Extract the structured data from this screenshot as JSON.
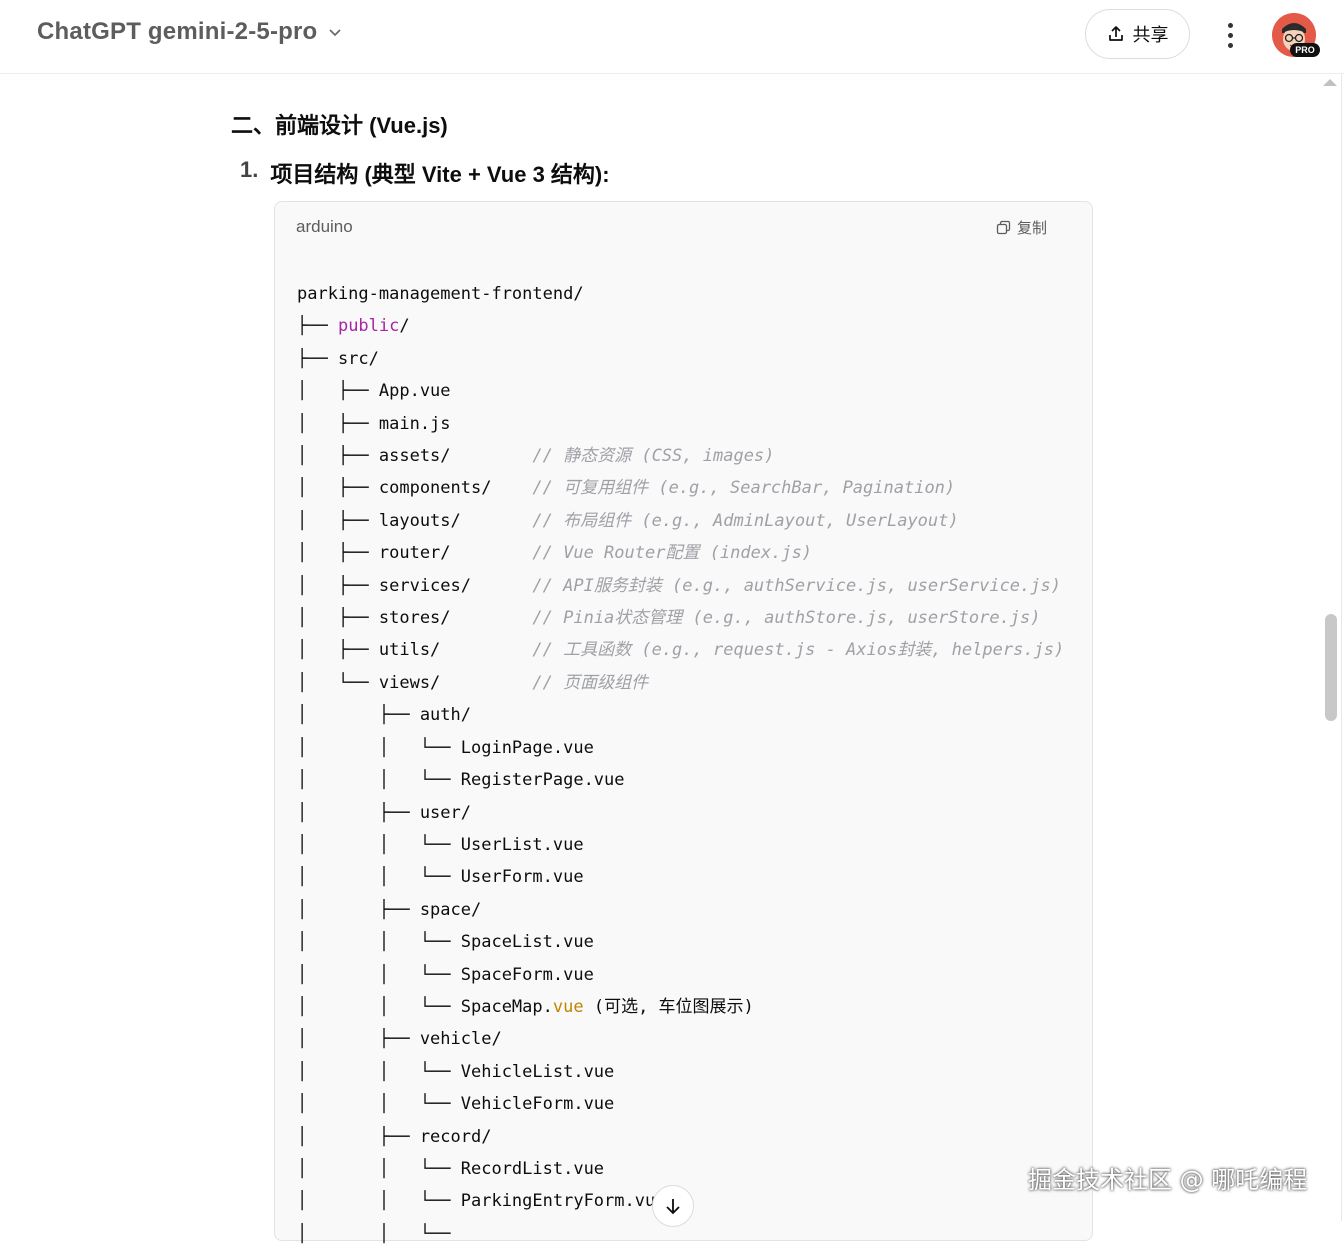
{
  "header": {
    "title": "ChatGPT gemini-2-5-pro",
    "share_label": "共享",
    "avatar_badge": "PRO"
  },
  "content": {
    "section_heading": "二、前端设计 (Vue.js)",
    "item_number": "1.",
    "item_heading": "项目结构 (典型 Vite + Vue 3 结构):"
  },
  "code_block": {
    "language": "arduino",
    "copy_label": "复制",
    "lines": [
      [
        {
          "t": "parking-management-frontend/"
        }
      ],
      [
        {
          "t": "├── "
        },
        {
          "t": "public",
          "c": "kw"
        },
        {
          "t": "/"
        }
      ],
      [
        {
          "t": "├── src/"
        }
      ],
      [
        {
          "t": "│   ├── App.vue"
        }
      ],
      [
        {
          "t": "│   ├── main.js"
        }
      ],
      [
        {
          "t": "│   ├── assets/        "
        },
        {
          "t": "// 静态资源 (CSS, images)",
          "c": "cmt"
        }
      ],
      [
        {
          "t": "│   ├── components/    "
        },
        {
          "t": "// 可复用组件 (e.g., SearchBar, Pagination)",
          "c": "cmt"
        }
      ],
      [
        {
          "t": "│   ├── layouts/       "
        },
        {
          "t": "// 布局组件 (e.g., AdminLayout, UserLayout)",
          "c": "cmt"
        }
      ],
      [
        {
          "t": "│   ├── router/        "
        },
        {
          "t": "// Vue Router配置 (index.js)",
          "c": "cmt"
        }
      ],
      [
        {
          "t": "│   ├── services/      "
        },
        {
          "t": "// API服务封装 (e.g., authService.js, userService.js)",
          "c": "cmt"
        }
      ],
      [
        {
          "t": "│   ├── stores/        "
        },
        {
          "t": "// Pinia状态管理 (e.g., authStore.js, userStore.js)",
          "c": "cmt"
        }
      ],
      [
        {
          "t": "│   ├── utils/         "
        },
        {
          "t": "// 工具函数 (e.g., request.js - Axios封装, helpers.js)",
          "c": "cmt"
        }
      ],
      [
        {
          "t": "│   └── views/         "
        },
        {
          "t": "// 页面级组件",
          "c": "cmt"
        }
      ],
      [
        {
          "t": "│       ├── auth/"
        }
      ],
      [
        {
          "t": "│       │   └── LoginPage.vue"
        }
      ],
      [
        {
          "t": "│       │   └── RegisterPage.vue"
        }
      ],
      [
        {
          "t": "│       ├── user/"
        }
      ],
      [
        {
          "t": "│       │   └── UserList.vue"
        }
      ],
      [
        {
          "t": "│       │   └── UserForm.vue"
        }
      ],
      [
        {
          "t": "│       ├── space/"
        }
      ],
      [
        {
          "t": "│       │   └── SpaceList.vue"
        }
      ],
      [
        {
          "t": "│       │   └── SpaceForm.vue"
        }
      ],
      [
        {
          "t": "│       │   └── SpaceMap."
        },
        {
          "t": "vue",
          "c": "vue"
        },
        {
          "t": " (可选, 车位图展示)"
        }
      ],
      [
        {
          "t": "│       ├── vehicle/"
        }
      ],
      [
        {
          "t": "│       │   └── VehicleList.vue"
        }
      ],
      [
        {
          "t": "│       │   └── VehicleForm.vue"
        }
      ],
      [
        {
          "t": "│       ├── record/"
        }
      ],
      [
        {
          "t": "│       │   └── RecordList.vue"
        }
      ],
      [
        {
          "t": "│       │   └── ParkingEntryForm.vue"
        }
      ],
      [
        {
          "t": "│       │   └──"
        }
      ]
    ]
  },
  "watermark": "掘金技术社区 @ 哪吒编程"
}
